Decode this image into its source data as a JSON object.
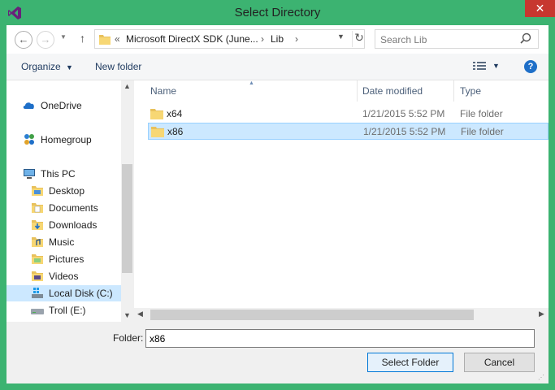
{
  "window": {
    "title": "Select Directory",
    "close_glyph": "✕",
    "accent_color": "#3cb371",
    "logo": "visual-studio-logo"
  },
  "address": {
    "back_glyph": "←",
    "forward_glyph": "→",
    "up_glyph": "↑",
    "overflow": "«",
    "crumbs": [
      "Microsoft DirectX SDK (June...",
      "Lib"
    ],
    "separator": "›",
    "refresh_glyph": "↻"
  },
  "search": {
    "placeholder": "Search Lib",
    "icon": "search-icon"
  },
  "toolbar": {
    "organize": "Organize",
    "new_folder": "New folder",
    "drop_glyph": "▼",
    "help_glyph": "?"
  },
  "nav": {
    "items": [
      {
        "label": "OneDrive",
        "icon": "cloud-icon"
      },
      {
        "label": "Homegroup",
        "icon": "homegroup-icon"
      },
      {
        "label": "This PC",
        "icon": "computer-icon"
      },
      {
        "label": "Desktop",
        "icon": "folder-icon"
      },
      {
        "label": "Documents",
        "icon": "folder-icon"
      },
      {
        "label": "Downloads",
        "icon": "folder-icon"
      },
      {
        "label": "Music",
        "icon": "folder-icon"
      },
      {
        "label": "Pictures",
        "icon": "folder-icon"
      },
      {
        "label": "Videos",
        "icon": "folder-icon"
      },
      {
        "label": "Local Disk (C:)",
        "icon": "drive-icon",
        "selected": true
      },
      {
        "label": "Troll (E:)",
        "icon": "drive-icon"
      }
    ]
  },
  "files": {
    "columns": [
      "Name",
      "Date modified",
      "Type"
    ],
    "rows": [
      {
        "name": "x64",
        "date": "1/21/2015 5:52 PM",
        "type": "File folder"
      },
      {
        "name": "x86",
        "date": "1/21/2015 5:52 PM",
        "type": "File folder",
        "selected": true
      }
    ]
  },
  "bottom": {
    "folder_label": "Folder:",
    "folder_value": "x86",
    "select_button": "Select Folder",
    "cancel_button": "Cancel"
  }
}
